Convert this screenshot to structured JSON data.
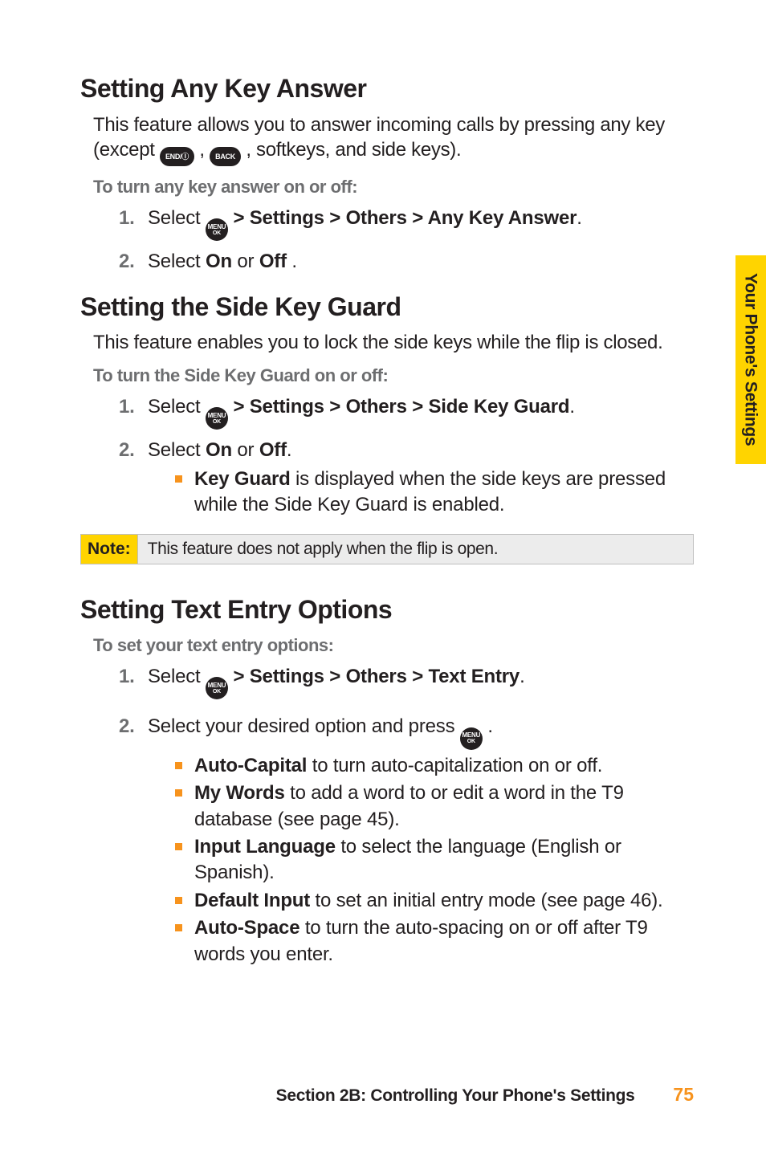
{
  "sideTab": "Your Phone's Settings",
  "icons": {
    "menuOkL1": "MENU",
    "menuOkL2": "OK",
    "end": "END/Ⓘ",
    "back": "BACK"
  },
  "sec1": {
    "heading": "Setting Any Key Answer",
    "intro_p1": "This feature allows you to answer incoming calls by pressing any key (except ",
    "intro_p2": " , ",
    "intro_p3": " , softkeys, and side keys).",
    "sub": "To turn any key answer on or off:",
    "step1_pre": "Select ",
    "step1_path": " > Settings > Others > Any Key Answer",
    "step1_post": ".",
    "step2_a": "Select ",
    "step2_on": "On",
    "step2_or": " or ",
    "step2_off": "Off",
    "step2_post": " ."
  },
  "sec2": {
    "heading": "Setting the Side Key Guard",
    "intro": "This feature enables you to lock the side keys while the flip is closed.",
    "sub": "To turn the Side Key Guard on or off:",
    "step1_pre": "Select ",
    "step1_path": " > Settings > Others > Side Key Guard",
    "step1_post": ".",
    "step2_a": "Select ",
    "step2_on": "On",
    "step2_or": " or ",
    "step2_off": "Off",
    "step2_post": ".",
    "bullet_a": "Key Guard",
    "bullet_b": " is displayed when the side keys are pressed while the Side Key Guard is enabled.",
    "noteLabel": "Note:",
    "noteBody": "This feature does not apply when the flip is open."
  },
  "sec3": {
    "heading": "Setting Text Entry Options",
    "sub": "To set your text entry options:",
    "step1_pre": "Select ",
    "step1_path": " > Settings > Others > Text Entry",
    "step1_post": ".",
    "step2_pre": "Select your desired option and press ",
    "step2_post": " .",
    "b1a": "Auto-Capital",
    "b1b": " to turn auto-capitalization on or off.",
    "b2a": "My Words",
    "b2b": " to add a word to or edit a word in the T9 database (see page 45).",
    "b3a": "Input Language",
    "b3b": " to select the language (English or Spanish).",
    "b4a": "Default Input",
    "b4b": " to set an initial entry mode (see page 46).",
    "b5a": "Auto-Space",
    "b5b": " to turn the auto-spacing on or off after T9 words you enter."
  },
  "footer": {
    "text": "Section 2B: Controlling Your Phone's Settings",
    "page": "75"
  }
}
